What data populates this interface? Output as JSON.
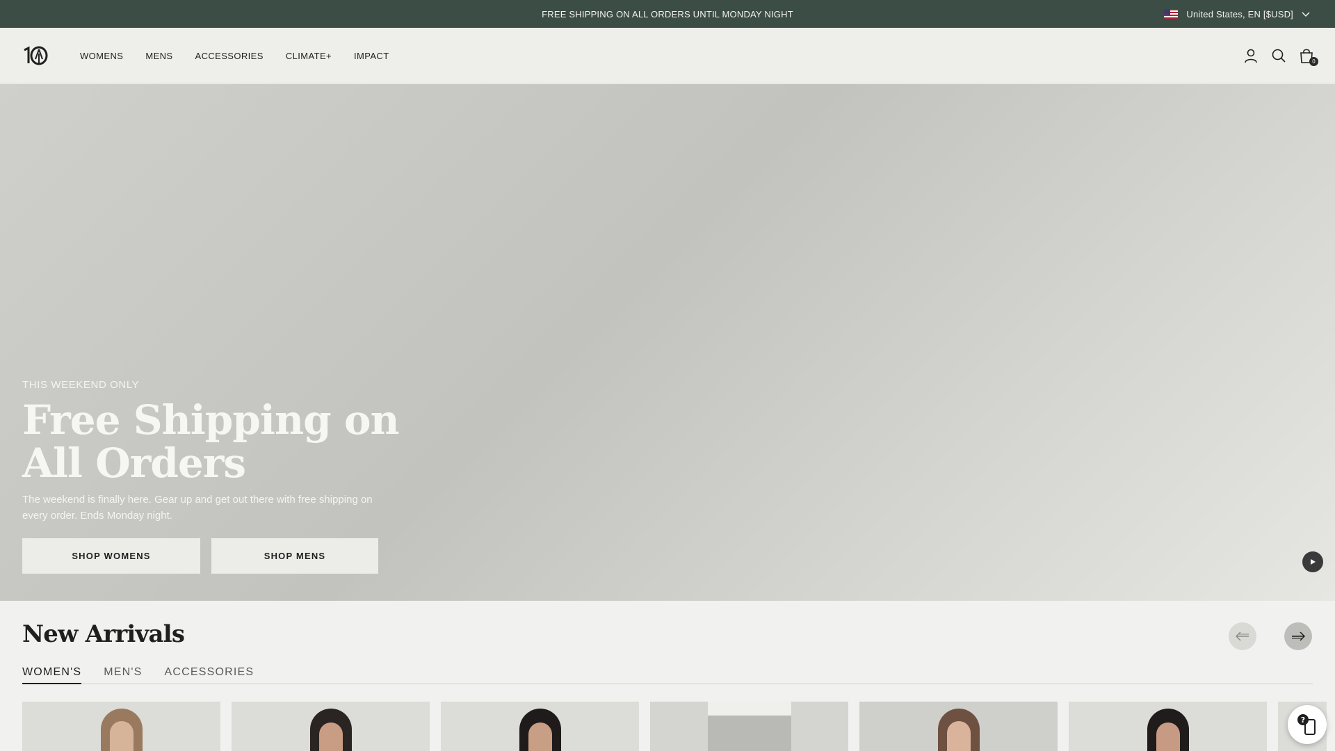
{
  "announcement": {
    "text": "FREE SHIPPING ON ALL ORDERS UNTIL MONDAY NIGHT"
  },
  "locale": {
    "label": "United States, EN [$USD]",
    "flag_icon": "us-flag-icon"
  },
  "header": {
    "logo_text": "10",
    "nav": [
      {
        "label": "WOMENS"
      },
      {
        "label": "MENS"
      },
      {
        "label": "ACCESSORIES"
      },
      {
        "label": "CLIMATE+"
      },
      {
        "label": "IMPACT"
      }
    ],
    "icons": [
      "account-icon",
      "search-icon",
      "bag-icon"
    ],
    "cart_count": "0"
  },
  "hero": {
    "eyebrow": "THIS WEEKEND ONLY",
    "title": "Free Shipping on All Orders",
    "description": "The weekend is finally here. Gear up and get out there with free shipping on every order. Ends Monday night.",
    "buttons": [
      {
        "label": "SHOP WOMENS"
      },
      {
        "label": "SHOP MENS"
      }
    ],
    "play_icon": "play-icon"
  },
  "arrivals": {
    "title": "New Arrivals",
    "tabs": [
      {
        "label": "WOMEN'S",
        "active": true
      },
      {
        "label": "MEN'S",
        "active": false
      },
      {
        "label": "ACCESSORIES",
        "active": false
      }
    ],
    "prev_icon": "arrow-left-icon",
    "next_icon": "arrow-right-icon"
  },
  "colors": {
    "announcement_bg": "#3c4d45",
    "header_bg": "#eeeeea",
    "page_bg": "#f1f1ef",
    "button_bg": "#ecece8",
    "text_dark": "#1f1f1f"
  }
}
